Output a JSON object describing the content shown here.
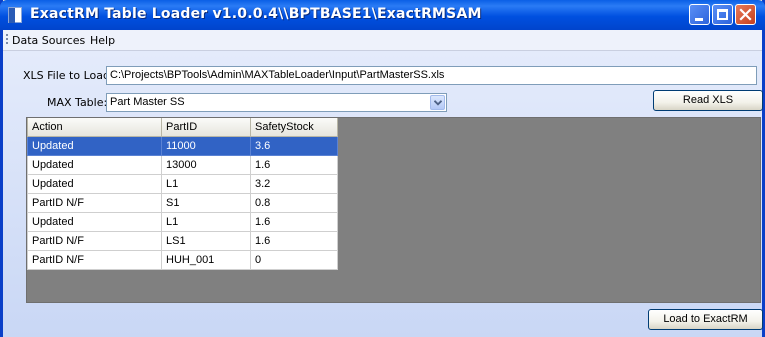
{
  "window": {
    "title": "ExactRM Table Loader v1.0.0.4\\\\BPTBASE1\\ExactRMSAM"
  },
  "menu": {
    "items": [
      "Data Sources",
      "Help"
    ]
  },
  "form": {
    "xls_label": "XLS File to Load:",
    "xls_value": "C:\\Projects\\BPTools\\Admin\\MAXTableLoader\\Input\\PartMasterSS.xls",
    "max_table_label": "MAX Table:",
    "max_table_value": "Part Master SS",
    "read_button": "Read XLS",
    "load_button": "Load to ExactRM"
  },
  "grid": {
    "columns": [
      "Action",
      "PartID",
      "SafetyStock"
    ],
    "rows": [
      {
        "action": "Updated",
        "part_id": "11000",
        "safety_stock": "3.6",
        "selected": true
      },
      {
        "action": "Updated",
        "part_id": "13000",
        "safety_stock": "1.6"
      },
      {
        "action": "Updated",
        "part_id": "L1",
        "safety_stock": "3.2"
      },
      {
        "action": "PartID N/F",
        "part_id": "S1",
        "safety_stock": "0.8"
      },
      {
        "action": "Updated",
        "part_id": "L1",
        "safety_stock": "1.6"
      },
      {
        "action": "PartID N/F",
        "part_id": "LS1",
        "safety_stock": "1.6"
      },
      {
        "action": "PartID N/F",
        "part_id": "HUH_001",
        "safety_stock": "0"
      }
    ]
  }
}
